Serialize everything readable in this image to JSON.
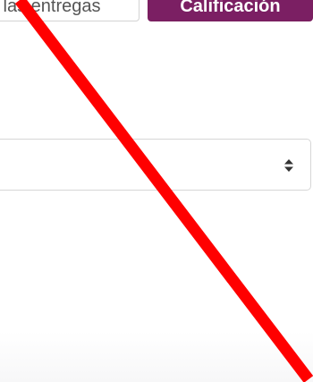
{
  "tabs": {
    "entregas_label": "las entregas",
    "calificacion_label": "Calificación"
  },
  "select": {
    "value": ""
  },
  "icons": {
    "select_arrows": "up-down-caret-icon"
  },
  "colors": {
    "accent": "#7b1f63",
    "overlay_slash": "#ff0000"
  }
}
